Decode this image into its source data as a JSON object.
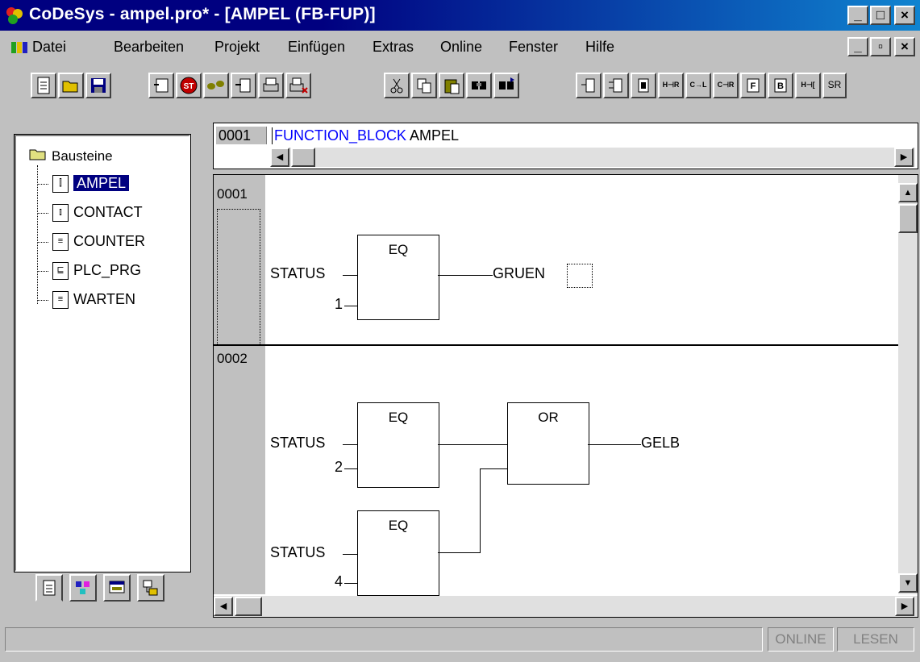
{
  "window": {
    "title": "CoDeSys - ampel.pro* - [AMPEL (FB-FUP)]",
    "controls": [
      "_",
      "□",
      "×"
    ]
  },
  "menu": {
    "items": [
      "Datei",
      "Bearbeiten",
      "Projekt",
      "Einfügen",
      "Extras",
      "Online",
      "Fenster",
      "Hilfe"
    ],
    "doc_controls": [
      "_",
      "▫",
      "×"
    ]
  },
  "toolbar": {
    "buttons": [
      "new-icon",
      "open-icon",
      "save-icon",
      "compile-icon",
      "stop-icon",
      "run-icon",
      "step-icon",
      "print-icon",
      "print-cancel-icon",
      "cut-icon",
      "copy-icon",
      "paste-icon",
      "find-icon",
      "find-next-icon",
      "insert-box-icon",
      "insert-input-icon",
      "insert-output-icon",
      "insert-negate-icon",
      "insert-contact-icon",
      "insert-contact-neg-icon",
      "insert-function-icon",
      "insert-fb-icon",
      "insert-jump-icon",
      "set-reset-icon"
    ],
    "sr_label": "SR"
  },
  "tree": {
    "root": "Bausteine",
    "items": [
      {
        "label": "AMPEL",
        "icon": "function-block-icon",
        "selected": true
      },
      {
        "label": "CONTACT",
        "icon": "contact-icon",
        "selected": false
      },
      {
        "label": "COUNTER",
        "icon": "program-icon",
        "selected": false
      },
      {
        "label": "PLC_PRG",
        "icon": "plc-program-icon",
        "selected": false
      },
      {
        "label": "WARTEN",
        "icon": "program-icon",
        "selected": false
      }
    ],
    "tabs": [
      "pou-tab-icon",
      "datatype-tab-icon",
      "visualization-tab-icon",
      "resources-tab-icon"
    ]
  },
  "declaration": {
    "line_no": "0001",
    "keyword": "FUNCTION_BLOCK",
    "name": "AMPEL"
  },
  "networks": [
    {
      "no": "0001",
      "block1": {
        "type": "EQ",
        "in1": "STATUS",
        "in2": "1",
        "out": "GRUEN"
      }
    },
    {
      "no": "0002",
      "block1": {
        "type": "EQ",
        "in1": "STATUS",
        "in2": "2"
      },
      "block2": {
        "type": "EQ",
        "in1": "STATUS",
        "in2": "4"
      },
      "block3": {
        "type": "OR",
        "out": "GELB"
      }
    }
  ],
  "status": {
    "online": "ONLINE",
    "read": "LESEN"
  }
}
